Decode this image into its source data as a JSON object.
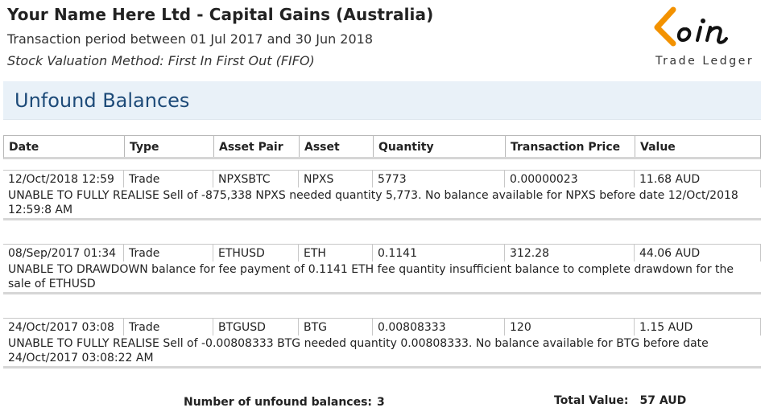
{
  "report": {
    "company_title": "Your Name Here Ltd - Capital Gains (Australia)",
    "period": "Transaction period between 01 Jul 2017 and 30 Jun 2018",
    "method": "Stock Valuation Method: First In First Out (FIFO)"
  },
  "logo": {
    "text": "Coin",
    "subtext": "Trade Ledger",
    "accent_color": "#f39200"
  },
  "section": {
    "title": "Unfound Balances"
  },
  "columns": [
    "Date",
    "Type",
    "Asset Pair",
    "Asset",
    "Quantity",
    "Transaction Price",
    "Value"
  ],
  "rows": [
    {
      "date": "12/Oct/2018 12:59",
      "type": "Trade",
      "pair": "NPXSBTC",
      "asset": "NPXS",
      "quantity": "5773",
      "price": "0.00000023",
      "value": "11.68 AUD",
      "message": "UNABLE TO FULLY REALISE Sell of -875,338 NPXS needed quantity 5,773. No balance available for NPXS before date 12/Oct/2018 12:59:8 AM"
    },
    {
      "date": "08/Sep/2017 01:34",
      "type": "Trade",
      "pair": "ETHUSD",
      "asset": "ETH",
      "quantity": "0.1141",
      "price": "312.28",
      "value": "44.06 AUD",
      "message": "UNABLE TO DRAWDOWN balance for fee payment of 0.1141 ETH fee quantity  insufficient balance to complete drawdown for the sale of ETHUSD"
    },
    {
      "date": "24/Oct/2017 03:08",
      "type": "Trade",
      "pair": "BTGUSD",
      "asset": "BTG",
      "quantity": "0.00808333",
      "price": "120",
      "value": "1.15 AUD",
      "message": "UNABLE TO FULLY REALISE Sell of -0.00808333 BTG needed quantity 0.00808333. No balance available for BTG before date 24/Oct/2017 03:08:22 AM"
    }
  ],
  "footer": {
    "count_label": "Number of unfound balances:",
    "count_value": "3",
    "total_label": "Total Value:",
    "total_value": "57 AUD"
  }
}
